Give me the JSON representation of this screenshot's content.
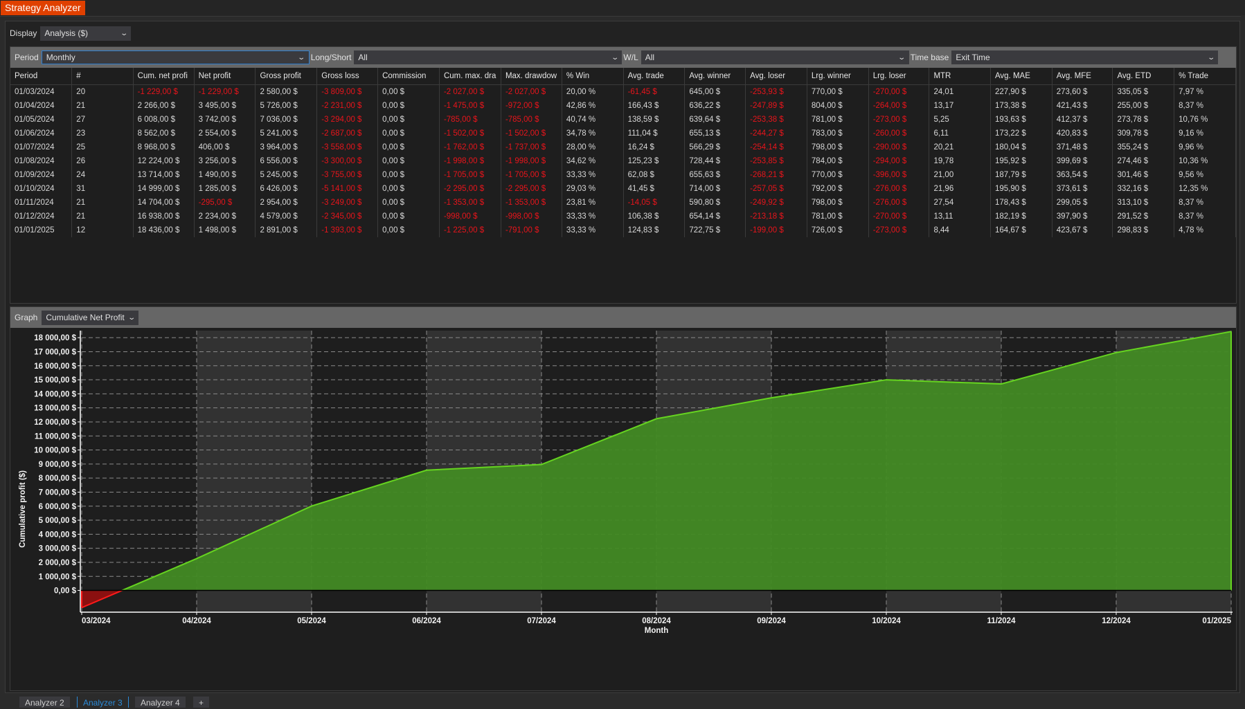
{
  "window": {
    "title": "Strategy Analyzer"
  },
  "display": {
    "label": "Display",
    "value": "Analysis ($)"
  },
  "filters": {
    "period": {
      "label": "Period",
      "value": "Monthly"
    },
    "long_short": {
      "label": "Long/Short",
      "value": "All"
    },
    "wl": {
      "label": "W/L",
      "value": "All"
    },
    "time_base": {
      "label": "Time base",
      "value": "Exit Time"
    }
  },
  "table": {
    "columns": [
      "Period",
      "#",
      "Cum. net profi",
      "Net profit",
      "Gross profit",
      "Gross loss",
      "Commission",
      "Cum. max. dra",
      "Max. drawdow",
      "% Win",
      "Avg. trade",
      "Avg. winner",
      "Avg. loser",
      "Lrg. winner",
      "Lrg. loser",
      "MTR",
      "Avg. MAE",
      "Avg. MFE",
      "Avg. ETD",
      "% Trade"
    ],
    "rows": [
      [
        "01/03/2024",
        "20",
        "-1 229,00 $",
        "-1 229,00 $",
        "2 580,00 $",
        "-3 809,00 $",
        "0,00 $",
        "-2 027,00 $",
        "-2 027,00 $",
        "20,00 %",
        "-61,45 $",
        "645,00 $",
        "-253,93 $",
        "770,00 $",
        "-270,00 $",
        "24,01",
        "227,90 $",
        "273,60 $",
        "335,05 $",
        "7,97 %"
      ],
      [
        "01/04/2024",
        "21",
        "2 266,00 $",
        "3 495,00 $",
        "5 726,00 $",
        "-2 231,00 $",
        "0,00 $",
        "-1 475,00 $",
        "-972,00 $",
        "42,86 %",
        "166,43 $",
        "636,22 $",
        "-247,89 $",
        "804,00 $",
        "-264,00 $",
        "13,17",
        "173,38 $",
        "421,43 $",
        "255,00 $",
        "8,37 %"
      ],
      [
        "01/05/2024",
        "27",
        "6 008,00 $",
        "3 742,00 $",
        "7 036,00 $",
        "-3 294,00 $",
        "0,00 $",
        "-785,00 $",
        "-785,00 $",
        "40,74 %",
        "138,59 $",
        "639,64 $",
        "-253,38 $",
        "781,00 $",
        "-273,00 $",
        "5,25",
        "193,63 $",
        "412,37 $",
        "273,78 $",
        "10,76 %"
      ],
      [
        "01/06/2024",
        "23",
        "8 562,00 $",
        "2 554,00 $",
        "5 241,00 $",
        "-2 687,00 $",
        "0,00 $",
        "-1 502,00 $",
        "-1 502,00 $",
        "34,78 %",
        "111,04 $",
        "655,13 $",
        "-244,27 $",
        "783,00 $",
        "-260,00 $",
        "6,11",
        "173,22 $",
        "420,83 $",
        "309,78 $",
        "9,16 %"
      ],
      [
        "01/07/2024",
        "25",
        "8 968,00 $",
        "406,00 $",
        "3 964,00 $",
        "-3 558,00 $",
        "0,00 $",
        "-1 762,00 $",
        "-1 737,00 $",
        "28,00 %",
        "16,24 $",
        "566,29 $",
        "-254,14 $",
        "798,00 $",
        "-290,00 $",
        "20,21",
        "180,04 $",
        "371,48 $",
        "355,24 $",
        "9,96 %"
      ],
      [
        "01/08/2024",
        "26",
        "12 224,00 $",
        "3 256,00 $",
        "6 556,00 $",
        "-3 300,00 $",
        "0,00 $",
        "-1 998,00 $",
        "-1 998,00 $",
        "34,62 %",
        "125,23 $",
        "728,44 $",
        "-253,85 $",
        "784,00 $",
        "-294,00 $",
        "19,78",
        "195,92 $",
        "399,69 $",
        "274,46 $",
        "10,36 %"
      ],
      [
        "01/09/2024",
        "24",
        "13 714,00 $",
        "1 490,00 $",
        "5 245,00 $",
        "-3 755,00 $",
        "0,00 $",
        "-1 705,00 $",
        "-1 705,00 $",
        "33,33 %",
        "62,08 $",
        "655,63 $",
        "-268,21 $",
        "770,00 $",
        "-396,00 $",
        "21,00",
        "187,79 $",
        "363,54 $",
        "301,46 $",
        "9,56 %"
      ],
      [
        "01/10/2024",
        "31",
        "14 999,00 $",
        "1 285,00 $",
        "6 426,00 $",
        "-5 141,00 $",
        "0,00 $",
        "-2 295,00 $",
        "-2 295,00 $",
        "29,03 %",
        "41,45 $",
        "714,00 $",
        "-257,05 $",
        "792,00 $",
        "-276,00 $",
        "21,96",
        "195,90 $",
        "373,61 $",
        "332,16 $",
        "12,35 %"
      ],
      [
        "01/11/2024",
        "21",
        "14 704,00 $",
        "-295,00 $",
        "2 954,00 $",
        "-3 249,00 $",
        "0,00 $",
        "-1 353,00 $",
        "-1 353,00 $",
        "23,81 %",
        "-14,05 $",
        "590,80 $",
        "-249,92 $",
        "798,00 $",
        "-276,00 $",
        "27,54",
        "178,43 $",
        "299,05 $",
        "313,10 $",
        "8,37 %"
      ],
      [
        "01/12/2024",
        "21",
        "16 938,00 $",
        "2 234,00 $",
        "4 579,00 $",
        "-2 345,00 $",
        "0,00 $",
        "-998,00 $",
        "-998,00 $",
        "33,33 %",
        "106,38 $",
        "654,14 $",
        "-213,18 $",
        "781,00 $",
        "-270,00 $",
        "13,11",
        "182,19 $",
        "397,90 $",
        "291,52 $",
        "8,37 %"
      ],
      [
        "01/01/2025",
        "12",
        "18 436,00 $",
        "1 498,00 $",
        "2 891,00 $",
        "-1 393,00 $",
        "0,00 $",
        "-1 225,00 $",
        "-791,00 $",
        "33,33 %",
        "124,83 $",
        "722,75 $",
        "-199,00 $",
        "726,00 $",
        "-273,00 $",
        "8,44",
        "164,67 $",
        "423,67 $",
        "298,83 $",
        "4,78 %"
      ]
    ]
  },
  "graph": {
    "label": "Graph",
    "value": "Cumulative Net Profit"
  },
  "colors": {
    "accent": "#e04000",
    "negative": "#e8141b",
    "positive_line": "#66d420",
    "positive_fill": "#428a24",
    "negative_fill": "#8b1010",
    "selected_tab": "#2b8ad8"
  },
  "chart_data": {
    "type": "area",
    "title": "Cumulative Net Profit",
    "xlabel": "Month",
    "ylabel": "Cumulative profit ($)",
    "categories": [
      "03/2024",
      "04/2024",
      "05/2024",
      "06/2024",
      "07/2024",
      "08/2024",
      "09/2024",
      "10/2024",
      "11/2024",
      "12/2024",
      "01/2025"
    ],
    "series": [
      {
        "name": "Cumulative Net Profit",
        "values": [
          -1229,
          2266,
          6008,
          8562,
          8968,
          12224,
          13714,
          14999,
          14704,
          16938,
          18436
        ]
      }
    ],
    "ylim": [
      -1500,
      18500
    ],
    "yticks": [
      0,
      1000,
      2000,
      3000,
      4000,
      5000,
      6000,
      7000,
      8000,
      9000,
      10000,
      11000,
      12000,
      13000,
      14000,
      15000,
      16000,
      17000,
      18000
    ],
    "ytick_labels": [
      "0,00 $",
      "1 000,00 $",
      "2 000,00 $",
      "3 000,00 $",
      "4 000,00 $",
      "5 000,00 $",
      "6 000,00 $",
      "7 000,00 $",
      "8 000,00 $",
      "9 000,00 $",
      "10 000,00 $",
      "11 000,00 $",
      "12 000,00 $",
      "13 000,00 $",
      "14 000,00 $",
      "15 000,00 $",
      "16 000,00 $",
      "17 000,00 $",
      "18 000,00 $"
    ],
    "grid": true,
    "legend": "none"
  },
  "bottom_tabs": [
    {
      "label": "Analyzer 2",
      "active": false
    },
    {
      "label": "Analyzer 3",
      "active": true
    },
    {
      "label": "Analyzer 4",
      "active": false
    },
    {
      "label": "+",
      "active": false
    }
  ]
}
